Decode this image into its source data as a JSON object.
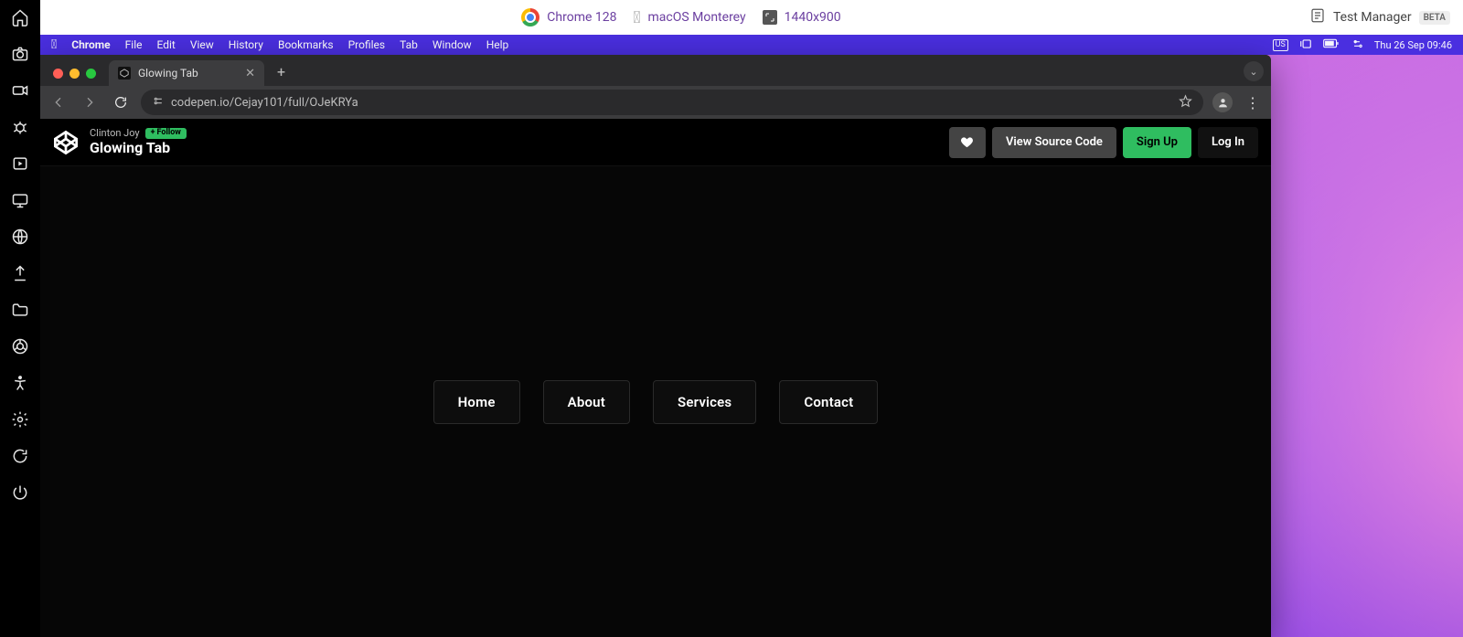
{
  "statusbar": {
    "browser": "Chrome 128",
    "os": "macOS Monterey",
    "resolution": "1440x900",
    "test_manager": "Test Manager",
    "beta": "BETA"
  },
  "mac_menu": {
    "app": "Chrome",
    "items": [
      "File",
      "Edit",
      "View",
      "History",
      "Bookmarks",
      "Profiles",
      "Tab",
      "Window",
      "Help"
    ],
    "input": "US",
    "datetime": "Thu 26 Sep  09:46"
  },
  "chrome": {
    "tab_title": "Glowing Tab",
    "url": "codepen.io/Cejay101/full/OJeKRYa"
  },
  "codepen": {
    "author": "Clinton Joy",
    "follow": "Follow",
    "title": "Glowing Tab",
    "view_source": "View Source Code",
    "sign_up": "Sign Up",
    "log_in": "Log In"
  },
  "demo": {
    "tabs": [
      "Home",
      "About",
      "Services",
      "Contact"
    ]
  }
}
